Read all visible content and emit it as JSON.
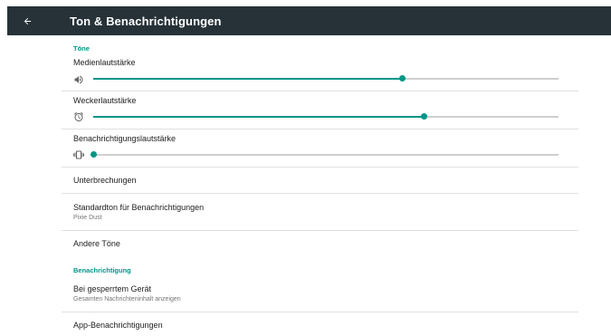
{
  "app_bar": {
    "title": "Ton & Benachrichtigungen",
    "back_icon": "arrow-back-icon"
  },
  "sections": {
    "tones_header": "Töne",
    "notification_header": "Benachrichtigung"
  },
  "volumes": [
    {
      "label": "Medienlautstärke",
      "icon": "speaker-icon",
      "level": 0.665
    },
    {
      "label": "Weckerlautstärke",
      "icon": "alarm-clock-icon",
      "level": 0.712
    },
    {
      "label": "Benachrichtigungslautstärke",
      "icon": "vibrate-icon",
      "level": 0.0
    }
  ],
  "items": {
    "interruptions": "Unterbrechungen",
    "default_tone_title": "Standardton für Benachrichtigungen",
    "default_tone_value": "Pixie Dust",
    "other_sounds": "Andere Töne",
    "locked_title": "Bei gesperrtem Gerät",
    "locked_value": "Gesamten Nachrichteninhalt anzeigen",
    "app_notifications": "App-Benachrichtigungen"
  },
  "colors": {
    "app_bar": "#263238",
    "accent": "#009688"
  }
}
